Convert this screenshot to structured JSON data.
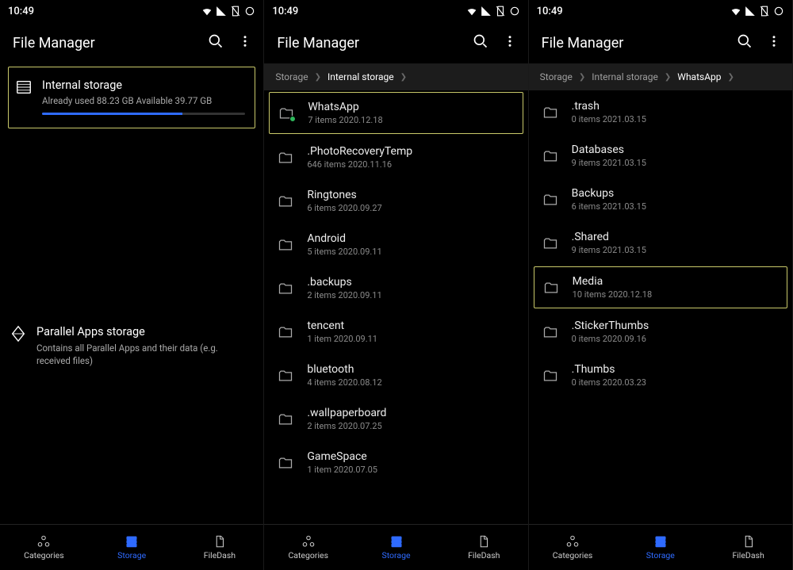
{
  "status": {
    "time": "10:49"
  },
  "appbar": {
    "title": "File Manager"
  },
  "bottomnav": {
    "categories": "Categories",
    "storage": "Storage",
    "filedash": "FileDash"
  },
  "screen1": {
    "internal": {
      "title": "Internal storage",
      "sub": "Already used 88.23 GB   Available 39.77 GB",
      "used_pct": 69
    },
    "parallel": {
      "title": "Parallel Apps storage",
      "sub": "Contains all Parallel Apps and their data (e.g. received files)"
    }
  },
  "screen2": {
    "breadcrumb": [
      {
        "label": "Storage",
        "active": false
      },
      {
        "label": "Internal storage",
        "active": true
      }
    ],
    "folders": [
      {
        "name": "WhatsApp",
        "meta": "7 items   2020.12.18",
        "highlighted": true,
        "badge": true
      },
      {
        "name": ".PhotoRecoveryTemp",
        "meta": "646 items   2020.11.16"
      },
      {
        "name": "Ringtones",
        "meta": "6 items   2020.09.27"
      },
      {
        "name": "Android",
        "meta": "5 items   2020.09.11"
      },
      {
        "name": ".backups",
        "meta": "2 items   2020.09.11"
      },
      {
        "name": "tencent",
        "meta": "1 item   2020.09.11"
      },
      {
        "name": "bluetooth",
        "meta": "4 items   2020.08.12"
      },
      {
        "name": ".wallpaperboard",
        "meta": "2 items   2020.07.25"
      },
      {
        "name": "GameSpace",
        "meta": "1 item   2020.07.05"
      }
    ]
  },
  "screen3": {
    "breadcrumb": [
      {
        "label": "Storage",
        "active": false
      },
      {
        "label": "Internal storage",
        "active": false
      },
      {
        "label": "WhatsApp",
        "active": true
      }
    ],
    "folders": [
      {
        "name": ".trash",
        "meta": "0 items   2021.03.15"
      },
      {
        "name": "Databases",
        "meta": "9 items   2021.03.15"
      },
      {
        "name": "Backups",
        "meta": "6 items   2021.03.15"
      },
      {
        "name": ".Shared",
        "meta": "9 items   2021.03.15"
      },
      {
        "name": "Media",
        "meta": "10 items   2020.12.18",
        "highlighted": true
      },
      {
        "name": ".StickerThumbs",
        "meta": "0 items   2020.09.16"
      },
      {
        "name": ".Thumbs",
        "meta": "0 items   2020.03.23"
      }
    ]
  }
}
